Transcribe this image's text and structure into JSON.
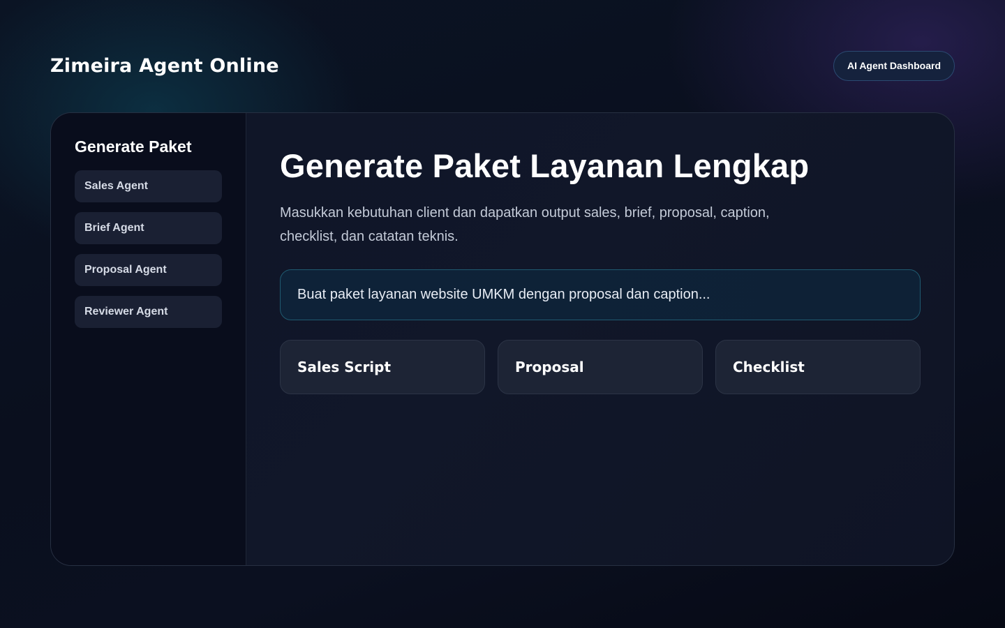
{
  "header": {
    "brand": "Zimeira Agent Online",
    "badge": "AI Agent Dashboard"
  },
  "sidebar": {
    "title": "Generate Paket",
    "items": [
      {
        "label": "Sales Agent"
      },
      {
        "label": "Brief Agent"
      },
      {
        "label": "Proposal Agent"
      },
      {
        "label": "Reviewer Agent"
      }
    ]
  },
  "main": {
    "title": "Generate Paket Layanan Lengkap",
    "description": "Masukkan kebutuhan client dan dapatkan output sales, brief, proposal, caption, checklist, dan catatan teknis.",
    "prompt": {
      "placeholder": "Buat paket layanan website UMKM dengan proposal dan caption..."
    },
    "cards": [
      {
        "label": "Sales Script"
      },
      {
        "label": "Proposal"
      },
      {
        "label": "Checklist"
      }
    ]
  },
  "colors": {
    "accent_border": "#1f5a70",
    "pill_bg": "#15223d",
    "card_bg": "#1d2435"
  }
}
